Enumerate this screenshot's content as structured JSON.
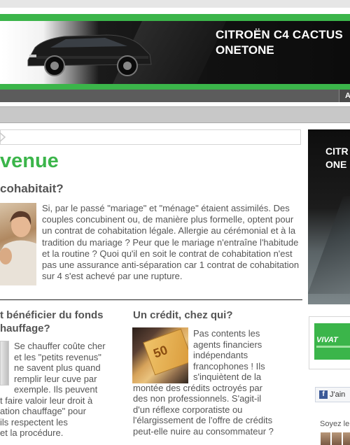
{
  "banner": {
    "line1": "CITROËN C4 CACTUS",
    "line2": "ONETONE",
    "brand_color": "#3bb54a"
  },
  "nav": {
    "tab_label": "A"
  },
  "main": {
    "title": "venue",
    "section_heading": "cohabitait?",
    "paragraph": "Si, par le passé \"mariage\" et \"ménage\" étaient assimilés. Des couples concubinent ou, de manière plus formelle, optent pour un contrat de cohabitation légale. Allergie au cérémonial et à la tradition du mariage ? Peur que le mariage n'entraîne l'habitude et la routine ? Quoi qu'il en soit le contrat de cohabitation n'est pas une assurance anti-séparation car 1 contrat de cohabitation sur 4 s'est achevé par une rupture."
  },
  "col_left": {
    "heading_line1": "t bénéficier du fonds",
    "heading_line2": "hauffage?",
    "text_line1": "Se chauffer coûte cher",
    "text_line2": "et les \"petits revenus\"",
    "text_line3": "ne savent plus quand",
    "text_line4": "remplir leur cuve par",
    "text_line5": "exemple. Ils peuvent",
    "text_line6": "t faire valoir leur droit à",
    "text_line7": "ation chauffage\" pour",
    "text_line8": "ils respectent les",
    "text_line9": "et la procédure."
  },
  "col_right": {
    "heading": "Un crédit, chez qui?",
    "text_line1": "Pas contents les",
    "text_line2": "agents financiers",
    "text_line3": "indépendants",
    "text_line4": "francophones ! Ils",
    "text_line5": "s'inquiètent de la",
    "text_line6": "montée des crédits octroyés par",
    "text_line7": "des non professionnels. S'agit-il",
    "text_line8": "d'un réflexe corporatiste ou",
    "text_line9": "l'élargissement de l'offre de crédits",
    "text_line10": "peut-elle nuire au consommateur ?",
    "money_label": "50"
  },
  "sidebar": {
    "ad_line1": "CITR",
    "ad_line2": "ONE",
    "vivat_label": "VIVAT",
    "fb_label": "J'ain",
    "fb_icon": "f",
    "soyez_label": "Soyez le"
  }
}
